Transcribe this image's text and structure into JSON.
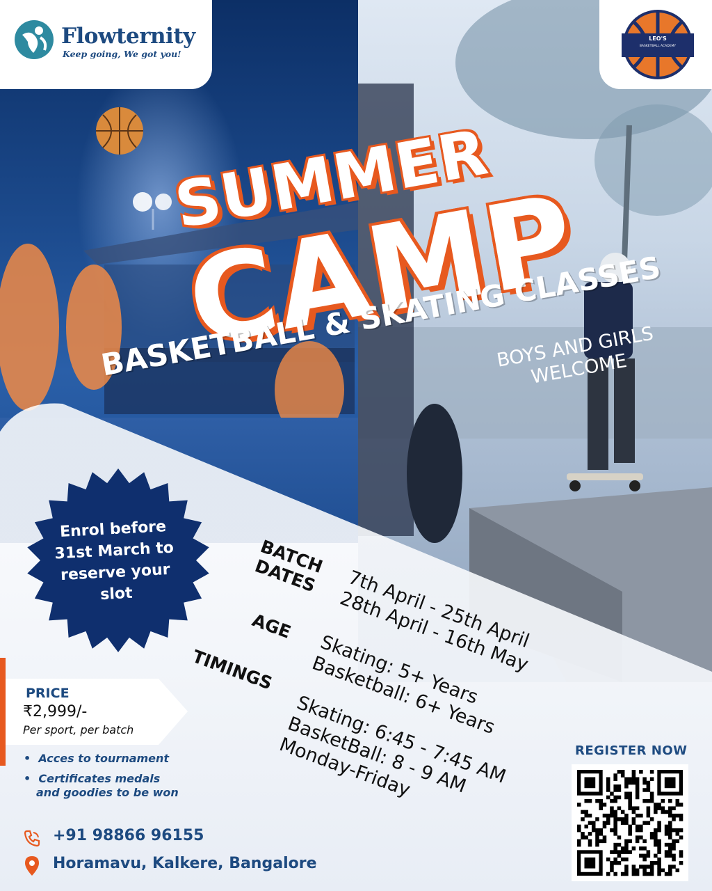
{
  "brand": {
    "name": "Flowternity",
    "tagline": "Keep going, We got you!"
  },
  "partner": {
    "line1": "LEO'S",
    "line2": "BASKETBALL ACADEMY"
  },
  "headline": {
    "summer": "SUMMER",
    "camp": "CAMP",
    "classes": "BASKETBALL & SKATING CLASSES",
    "welcome": "BOYS AND GIRLS WELCOME"
  },
  "badge": {
    "text": "Enrol before 31st March to reserve your slot"
  },
  "details": {
    "batch_label_1": "BATCH",
    "batch_label_2": "DATES",
    "batch_1": "7th April - 25th April",
    "batch_2": "28th April - 16th May",
    "age_label": "AGE",
    "age_1": "Skating: 5+ Years",
    "age_2": "Basketball: 6+ Years",
    "timings_label": "TIMINGS",
    "timing_1": "Skating: 6:45 - 7:45 AM",
    "timing_2": "BasketBall: 8 - 9 AM",
    "timing_3": "Monday-Friday"
  },
  "price": {
    "label": "PRICE",
    "amount": "₹2,999/-",
    "note": "Per sport, per batch",
    "benefits": [
      "Acces to tournament",
      "Certificates medals",
      "and goodies to be won"
    ]
  },
  "contact": {
    "phone": "+91 98866 96155",
    "address": "Horamavu, Kalkere, Bangalore"
  },
  "register": {
    "label": "REGISTER NOW"
  },
  "colors": {
    "navy": "#1d4a80",
    "orange": "#e7591f",
    "badge": "#0f2f6e"
  }
}
